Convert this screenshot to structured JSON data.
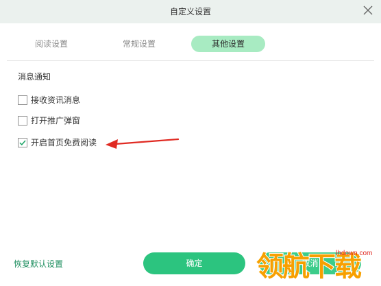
{
  "window": {
    "title": "自定义设置"
  },
  "tabs": [
    {
      "label": "阅读设置",
      "active": false
    },
    {
      "label": "常规设置",
      "active": false
    },
    {
      "label": "其他设置",
      "active": true
    }
  ],
  "section": {
    "title": "消息通知"
  },
  "options": [
    {
      "label": "接收资讯消息",
      "checked": false
    },
    {
      "label": "打开推广弹窗",
      "checked": false
    },
    {
      "label": "开启首页免费阅读",
      "checked": true
    }
  ],
  "footer": {
    "restore_label": "恢复默认设置",
    "ok_label": "确定",
    "cancel_label": "取消"
  },
  "watermark": {
    "text": "领航下载",
    "url": "lhdown.com"
  },
  "colors": {
    "accent": "#2cc47f",
    "active_tab_bg": "#a8ebc2",
    "titlebar_bg": "#ebf1ee",
    "annotation_arrow": "#e02a22",
    "watermark": "#f7a000"
  },
  "icons": [
    "close-icon",
    "checkmark-icon",
    "red-arrow-annotation"
  ]
}
